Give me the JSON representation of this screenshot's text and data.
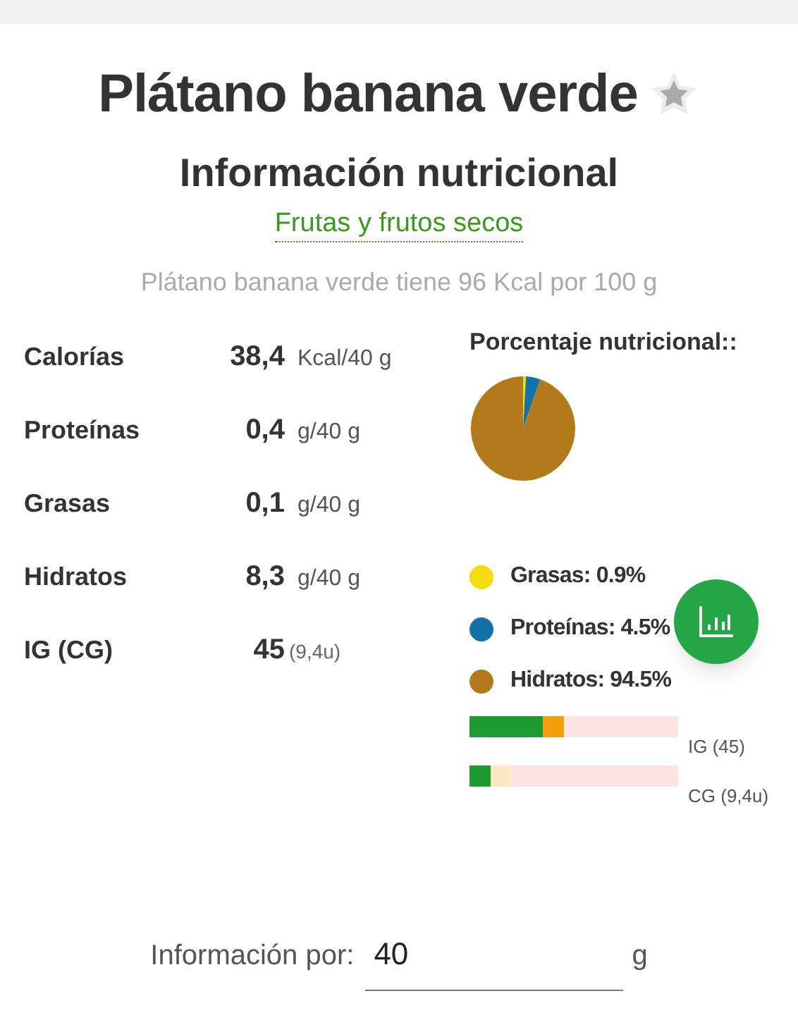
{
  "title": "Plátano banana verde",
  "subtitle": "Información nutricional",
  "category_link": "Frutas y frutos secos",
  "description": "Plátano banana verde tiene 96 Kcal por 100 g",
  "nutrients": [
    {
      "label": "Calorías",
      "value": "38,4",
      "unit": "Kcal/40 g"
    },
    {
      "label": "Proteínas",
      "value": "0,4",
      "unit": "g/40 g"
    },
    {
      "label": "Grasas",
      "value": "0,1",
      "unit": "g/40 g"
    },
    {
      "label": "Hidratos",
      "value": "8,3",
      "unit": "g/40 g"
    },
    {
      "label": "IG (CG)",
      "value": "45",
      "unit": "(9,4u)"
    }
  ],
  "percentage_title": "Porcentaje nutricional::",
  "chart_data": {
    "type": "pie",
    "values": [
      0.9,
      4.5,
      94.5
    ]
  },
  "legend": [
    {
      "label": "Grasas: 0.9%",
      "color": "#f5dc0c"
    },
    {
      "label": "Proteínas: 4.5%",
      "color": "#1572a8"
    },
    {
      "label": "Hidratos: 94.5%",
      "color": "#b27a18"
    }
  ],
  "index_bars": [
    {
      "label": "IG (45)"
    },
    {
      "label": "CG (9,4u)"
    }
  ],
  "serving": {
    "label": "Información por:",
    "value": "40",
    "unit": "g"
  }
}
